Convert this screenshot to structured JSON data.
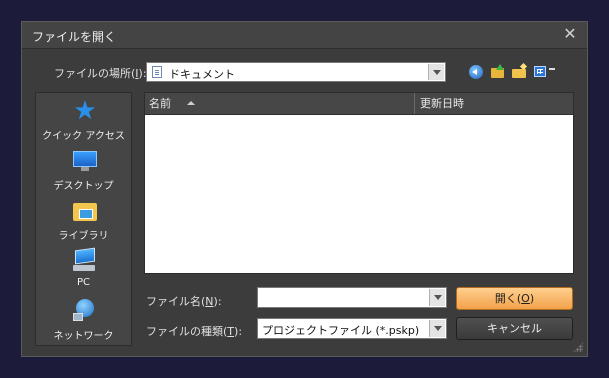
{
  "window": {
    "title": "ファイルを開く",
    "close_glyph": "✕"
  },
  "lookin": {
    "label_prefix": "ファイルの場所(",
    "label_key": "I",
    "label_suffix": "):",
    "value": "ドキュメント",
    "icon": "document-folder-icon"
  },
  "toolbar": {
    "icons": [
      "back-icon",
      "up-folder-icon",
      "new-folder-icon",
      "view-menu-icon"
    ]
  },
  "places": [
    {
      "label": "クイック アクセス",
      "icon": "star-icon"
    },
    {
      "label": "デスクトップ",
      "icon": "desktop-icon"
    },
    {
      "label": "ライブラリ",
      "icon": "library-icon"
    },
    {
      "label": "PC",
      "icon": "pc-icon"
    },
    {
      "label": "ネットワーク",
      "icon": "network-icon"
    }
  ],
  "filelist": {
    "columns": [
      {
        "label": "名前",
        "sorted": "ascending"
      },
      {
        "label": "更新日時"
      }
    ],
    "rows": []
  },
  "filename": {
    "label_prefix": "ファイル名(",
    "label_key": "N",
    "label_suffix": "):",
    "value": ""
  },
  "filetype": {
    "label_prefix": "ファイルの種類(",
    "label_key": "T",
    "label_suffix": "):",
    "value": "プロジェクトファイル (*.pskp)"
  },
  "buttons": {
    "open_prefix": "開く(",
    "open_key": "O",
    "open_suffix": ")",
    "cancel": "キャンセル"
  },
  "colors": {
    "background": "#1c1b3a",
    "dialog": "#3c3c3c",
    "open_button": "#f2a24a"
  }
}
